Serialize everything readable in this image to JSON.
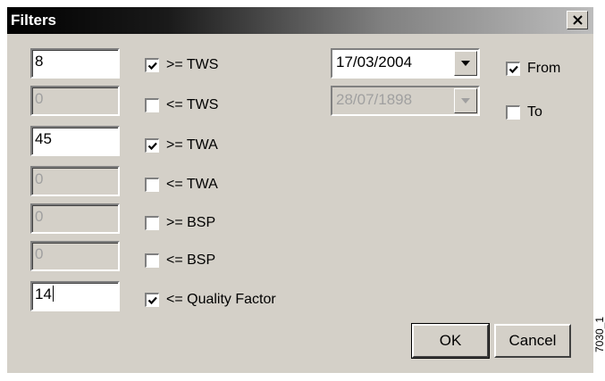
{
  "window": {
    "title": "Filters",
    "close_icon": "close-icon"
  },
  "filters": [
    {
      "value": "8",
      "enabled": true,
      "checked": true,
      "label": ">= TWS"
    },
    {
      "value": "0",
      "enabled": false,
      "checked": false,
      "label": "<= TWS"
    },
    {
      "value": "45",
      "enabled": true,
      "checked": true,
      "label": ">= TWA"
    },
    {
      "value": "0",
      "enabled": false,
      "checked": false,
      "label": "<= TWA"
    },
    {
      "value": "0",
      "enabled": false,
      "checked": false,
      "label": ">= BSP"
    },
    {
      "value": "0",
      "enabled": false,
      "checked": false,
      "label": "<= BSP"
    },
    {
      "value": "14",
      "enabled": true,
      "checked": true,
      "label": "<= Quality Factor"
    }
  ],
  "date_range": {
    "from": {
      "value": "17/03/2004",
      "enabled": true,
      "checked": true,
      "label": "From"
    },
    "to": {
      "value": "28/07/1898",
      "enabled": false,
      "checked": false,
      "label": "To"
    }
  },
  "buttons": {
    "ok_label": "OK",
    "cancel_label": "Cancel"
  },
  "figure_id": "7030_1"
}
